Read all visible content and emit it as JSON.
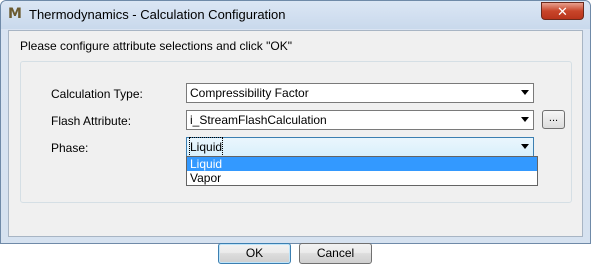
{
  "window": {
    "title": "Thermodynamics - Calculation Configuration",
    "icon": "M",
    "close_label": "✕"
  },
  "instruction": "Please configure attribute selections and click \"OK\"",
  "fields": {
    "calculation_type": {
      "label": "Calculation Type:",
      "value": "Compressibility Factor"
    },
    "flash_attribute": {
      "label": "Flash Attribute:",
      "value": "i_StreamFlashCalculation",
      "browse_label": "..."
    },
    "phase": {
      "label": "Phase:",
      "value": "Liquid"
    }
  },
  "phase_dropdown": {
    "options": [
      "Liquid",
      "Vapor"
    ],
    "selected_index": 0
  },
  "buttons": {
    "ok": "OK",
    "cancel": "Cancel"
  },
  "colors": {
    "selection": "#3399ff",
    "focus_border": "#3c7fb1"
  }
}
